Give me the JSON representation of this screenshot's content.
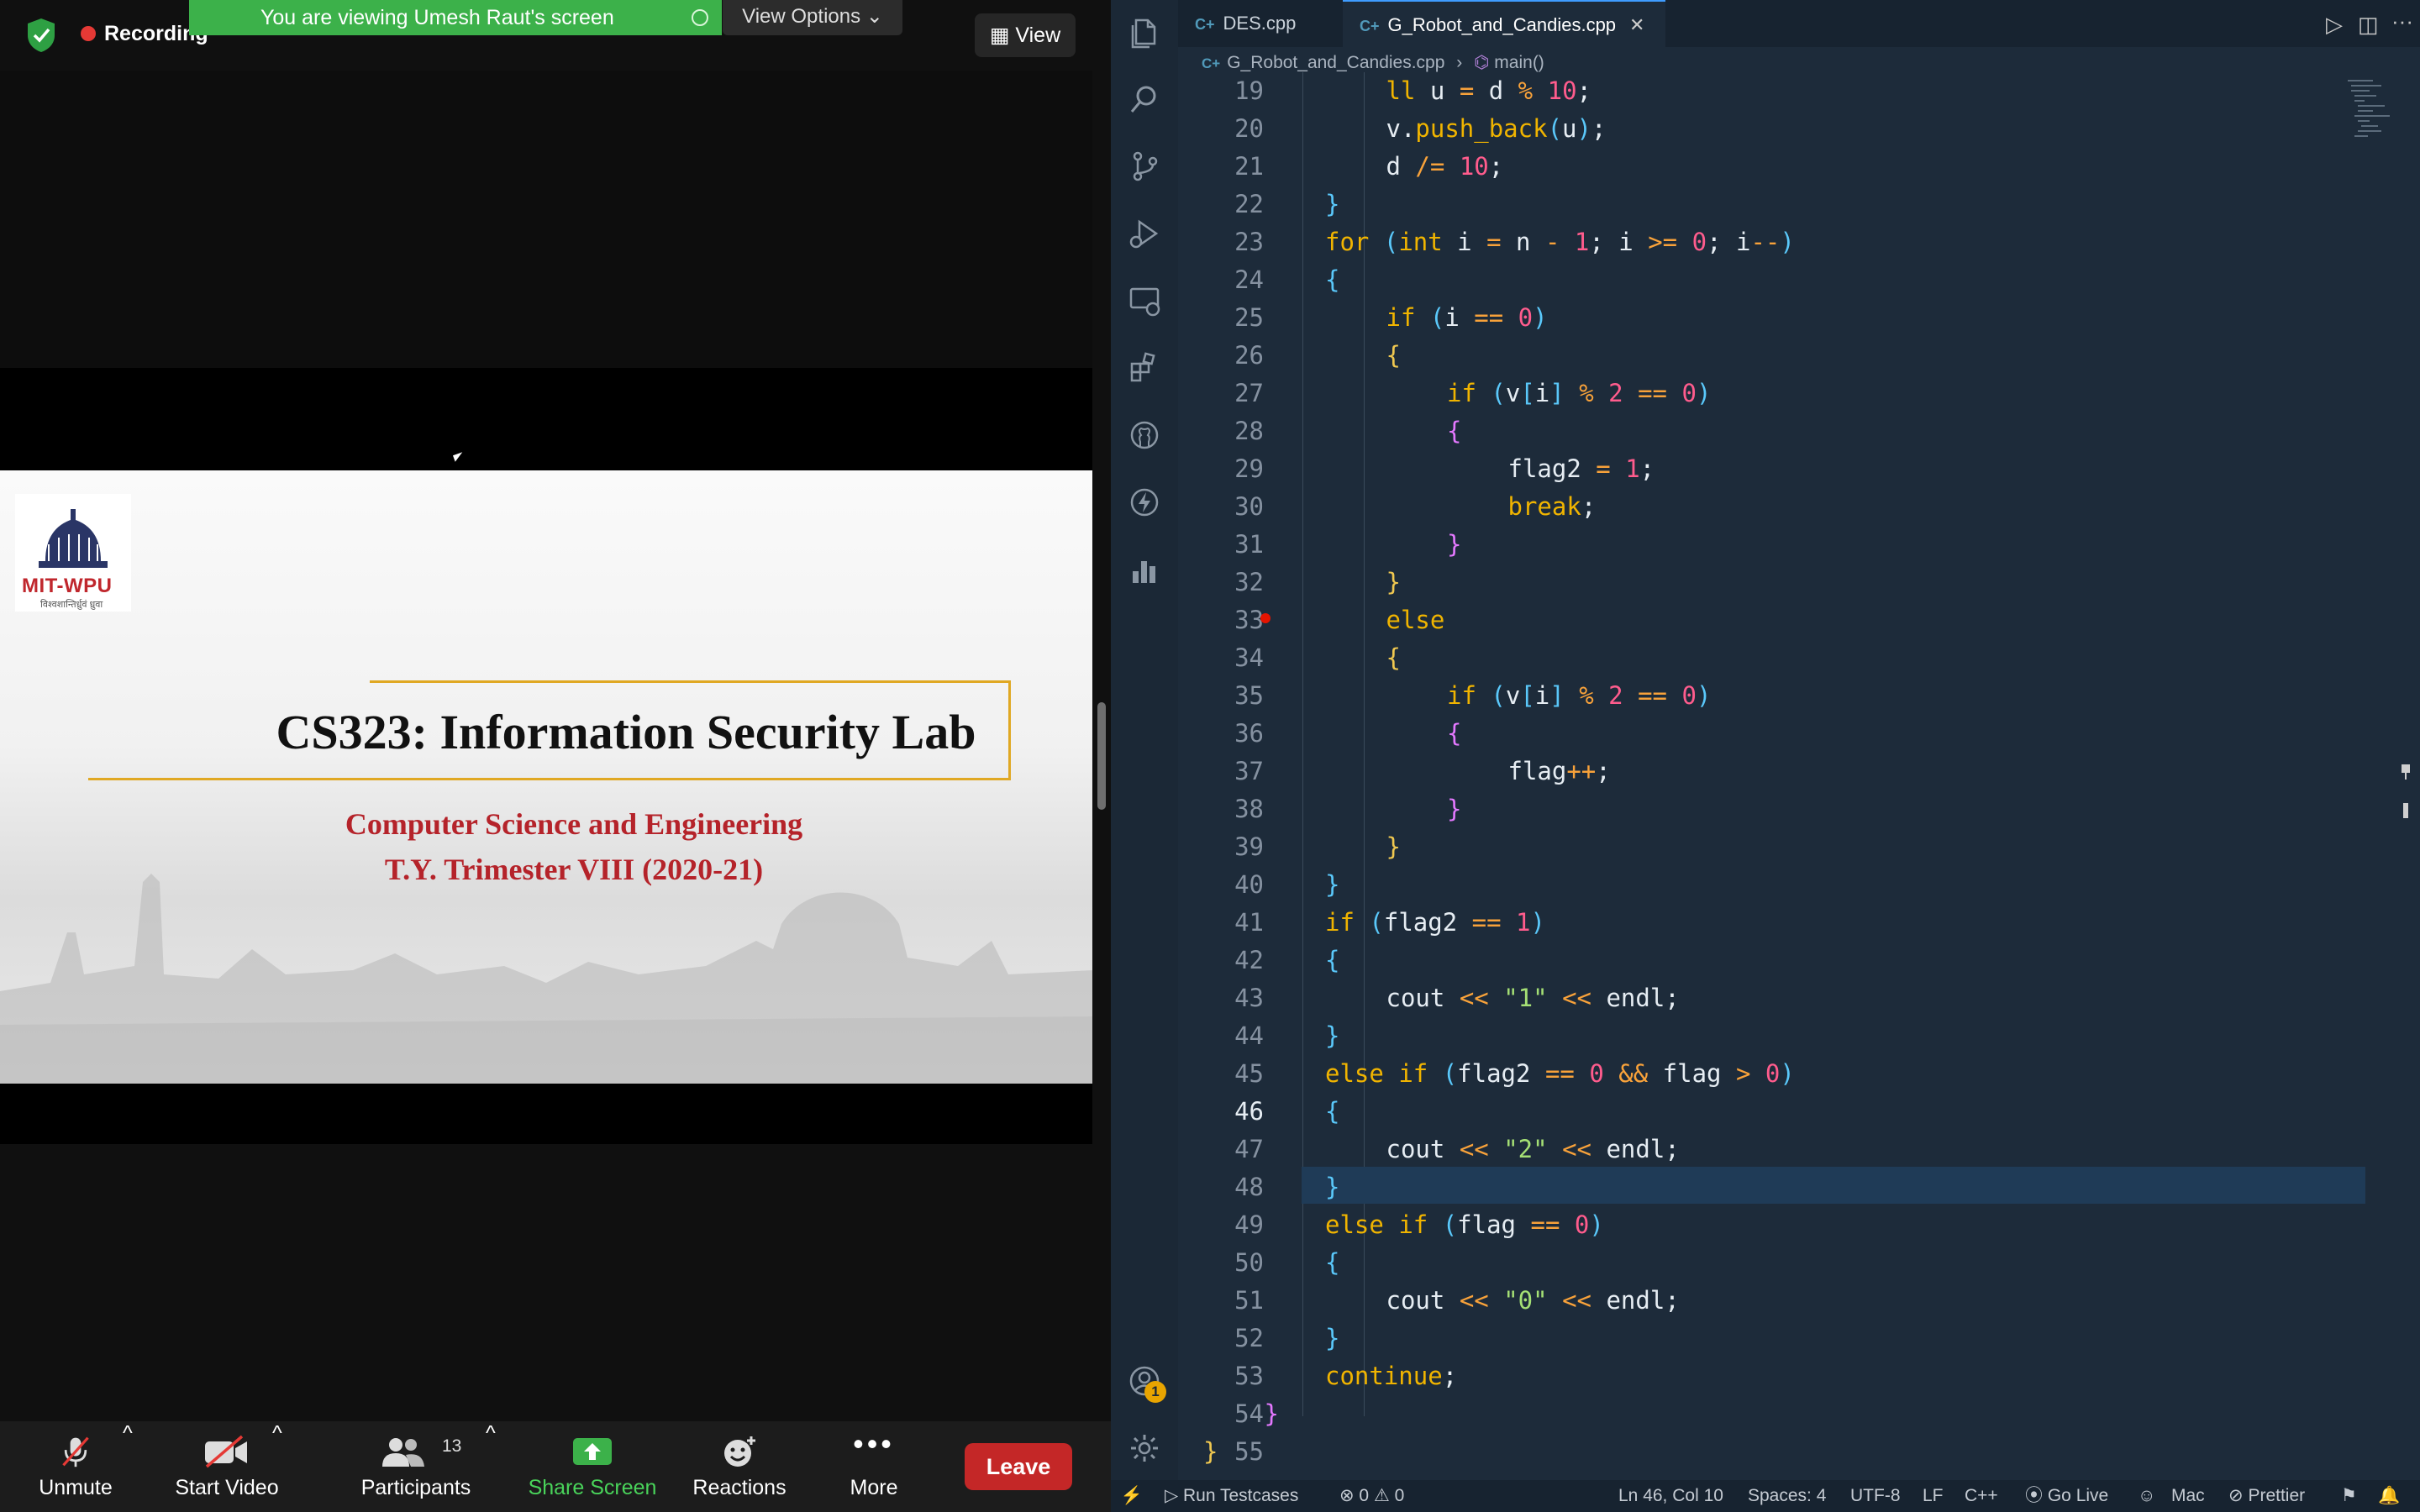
{
  "zoom": {
    "recording_label": "Recording",
    "viewing_banner": "You are viewing Umesh Raut's screen",
    "view_options_label": "View Options",
    "view_button_label": "View",
    "slide": {
      "logo_text": "MIT-WPU",
      "logo_subtext": "विश्वशान्तिर्ध्रुवं ध्रुवा",
      "title": "CS323: Information Security Lab",
      "subtitle1": "Computer Science and Engineering",
      "subtitle2": "T.Y. Trimester VIII (2020-21)"
    },
    "toolbar": {
      "unmute": "Unmute",
      "start_video": "Start Video",
      "participants": "Participants",
      "participants_count": "13",
      "share_screen": "Share Screen",
      "reactions": "Reactions",
      "more": "More",
      "leave": "Leave"
    },
    "colors": {
      "banner": "#3cb14a",
      "leave": "#c42727",
      "share": "#3cb14a"
    }
  },
  "vscode": {
    "tabs": [
      {
        "label": "DES.cpp",
        "active": false
      },
      {
        "label": "G_Robot_and_Candies.cpp",
        "active": true
      }
    ],
    "breadcrumb": {
      "file": "G_Robot_and_Candies.cpp",
      "symbol": "main()"
    },
    "breakpoint_line": "31",
    "current_line": "46",
    "accounts_badge": "1",
    "status": {
      "run_testcases": "Run Testcases",
      "problems": "⊗ 0 ⚠ 0",
      "position": "Ln 46, Col 10",
      "spaces": "Spaces: 4",
      "encoding": "UTF-8",
      "eol": "LF",
      "language": "C++",
      "go_live": "Go Live",
      "os": "Mac",
      "prettier": "Prettier"
    },
    "code_lines": [
      {
        "n": "19",
        "indent": 3,
        "text": "ll u = d % 10;"
      },
      {
        "n": "20",
        "indent": 3,
        "text": "v.push_back(u);"
      },
      {
        "n": "21",
        "indent": 3,
        "text": "d /= 10;"
      },
      {
        "n": "22",
        "indent": 2,
        "text": "}"
      },
      {
        "n": "23",
        "indent": 2,
        "text": "for (int i = n - 1; i >= 0; i--)"
      },
      {
        "n": "24",
        "indent": 2,
        "text": "{"
      },
      {
        "n": "25",
        "indent": 3,
        "text": "if (i == 0)"
      },
      {
        "n": "26",
        "indent": 3,
        "text": "{"
      },
      {
        "n": "27",
        "indent": 4,
        "text": "if (v[i] % 2 == 0)"
      },
      {
        "n": "28",
        "indent": 4,
        "text": "{"
      },
      {
        "n": "29",
        "indent": 5,
        "text": "flag2 = 1;"
      },
      {
        "n": "30",
        "indent": 5,
        "text": "break;"
      },
      {
        "n": "31",
        "indent": 4,
        "text": "}"
      },
      {
        "n": "32",
        "indent": 3,
        "text": "}"
      },
      {
        "n": "33",
        "indent": 3,
        "text": "else"
      },
      {
        "n": "34",
        "indent": 3,
        "text": "{"
      },
      {
        "n": "35",
        "indent": 4,
        "text": "if (v[i] % 2 == 0)"
      },
      {
        "n": "36",
        "indent": 4,
        "text": "{"
      },
      {
        "n": "37",
        "indent": 5,
        "text": "flag++;"
      },
      {
        "n": "38",
        "indent": 4,
        "text": "}"
      },
      {
        "n": "39",
        "indent": 3,
        "text": "}"
      },
      {
        "n": "40",
        "indent": 2,
        "text": "}"
      },
      {
        "n": "41",
        "indent": 2,
        "text": "if (flag2 == 1)"
      },
      {
        "n": "42",
        "indent": 2,
        "text": "{"
      },
      {
        "n": "43",
        "indent": 3,
        "text": "cout << \"1\" << endl;"
      },
      {
        "n": "44",
        "indent": 2,
        "text": "}"
      },
      {
        "n": "45",
        "indent": 2,
        "text": "else if (flag2 == 0 && flag > 0)"
      },
      {
        "n": "46",
        "indent": 2,
        "text": "{"
      },
      {
        "n": "47",
        "indent": 3,
        "text": "cout << \"2\" << endl;"
      },
      {
        "n": "48",
        "indent": 2,
        "text": "}"
      },
      {
        "n": "49",
        "indent": 2,
        "text": "else if (flag == 0)"
      },
      {
        "n": "50",
        "indent": 2,
        "text": "{"
      },
      {
        "n": "51",
        "indent": 3,
        "text": "cout << \"0\" << endl;"
      },
      {
        "n": "52",
        "indent": 2,
        "text": "}"
      },
      {
        "n": "53",
        "indent": 2,
        "text": "continue;"
      },
      {
        "n": "54",
        "indent": 1,
        "text": "}"
      },
      {
        "n": "55",
        "indent": 0,
        "text": "}"
      }
    ]
  }
}
